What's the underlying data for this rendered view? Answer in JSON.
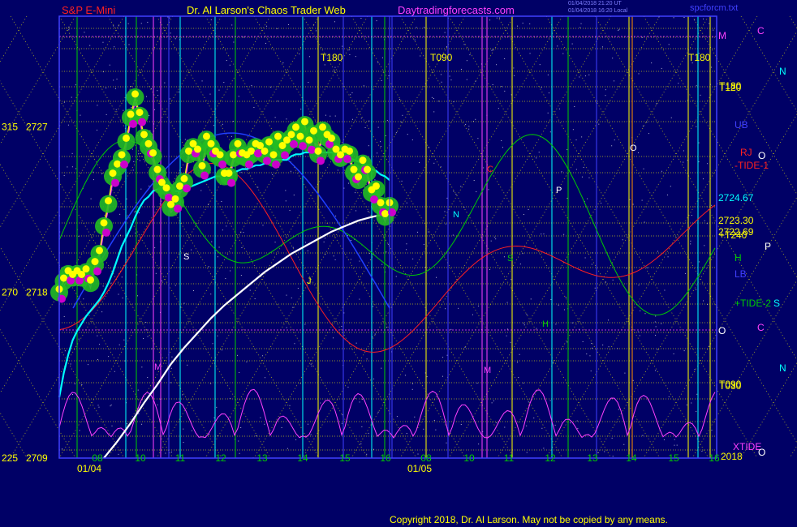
{
  "header": {
    "instrument": "S&P E-Mini",
    "site_title": "Dr. Al Larson's Chaos Trader Web",
    "site_url": "Daytradingforecasts.com",
    "stamp_line1": "01/04/2018 21:20 UT",
    "stamp_line2": "01/04/2018 16:20 Local",
    "file_name": "spcforcm.txt"
  },
  "footer": {
    "copyright": "Copyright 2018, Dr. Al Larson. May not be copied by any means."
  },
  "colors": {
    "background": "#000066",
    "price_bar": "#ffff00",
    "fast_average": "#00ffff",
    "slow_average": "#ffffff",
    "tide_curve": "#00cc00",
    "red_curve": "#ff2020",
    "xtide_curve": "#ff40ff",
    "grid_dots": "#ffff00"
  },
  "chart_data": {
    "type": "line",
    "y_axis_labels": [
      {
        "left": "315",
        "right": "2727"
      },
      {
        "left": "270",
        "right": "2718"
      },
      {
        "left": "225",
        "right": "2709"
      }
    ],
    "ylim": [
      2709,
      2733
    ],
    "x_hour_ticks": [
      "08",
      "10",
      "11",
      "12",
      "13",
      "14",
      "15",
      "16",
      "08",
      "10",
      "11",
      "12",
      "13",
      "14",
      "15",
      "16"
    ],
    "x_date_labels": [
      "01/04",
      "01/05"
    ],
    "right_year_label": "2018",
    "right_price_levels": [
      {
        "label": "2724.67",
        "value": 2724.67
      },
      {
        "label": "2723.30",
        "value": 2723.3
      },
      {
        "label": "2722.69",
        "value": 2722.69
      }
    ],
    "right_labels": [
      "T180",
      "T120",
      "UB",
      "RJ",
      "-TIDE-1",
      "+T240",
      "H",
      "LB",
      "+TIDE-2",
      "T090",
      "T030",
      "XTIDE"
    ],
    "top_labels": [
      "T180",
      "T090",
      "T180"
    ],
    "side_letters": [
      "C",
      "N",
      "M",
      "P",
      "S",
      "C",
      "N",
      "O",
      "O",
      "O"
    ],
    "curve_labels": [
      "N",
      "P",
      "S",
      "H",
      "M",
      "C",
      "O",
      "S",
      "M",
      "J"
    ],
    "series": [
      {
        "name": "",
        "x": [
          0.0,
          0.1,
          0.2,
          0.3,
          0.4,
          0.5,
          0.6,
          0.7,
          0.8,
          0.9,
          1.0,
          1.1,
          1.2,
          1.3,
          1.4,
          1.5,
          1.6,
          1.7,
          1.8,
          1.9,
          2.0,
          2.1,
          2.2,
          2.3,
          2.4,
          2.5,
          2.6,
          2.7,
          2.8,
          2.9,
          3.0,
          3.1,
          3.2,
          3.3,
          3.4,
          3.5,
          3.6,
          3.7,
          3.8,
          3.9,
          4.0,
          4.1,
          4.2,
          4.3,
          4.4,
          4.5,
          4.6,
          4.7,
          4.8,
          4.9,
          5.0,
          5.1,
          5.2,
          5.3,
          5.4,
          5.5,
          5.6,
          5.7,
          5.8,
          5.9,
          6.0,
          6.1,
          6.2,
          6.3,
          6.4,
          6.5,
          6.6,
          6.7,
          6.8,
          6.9,
          7.0,
          7.1,
          7.2,
          7.3,
          7.4
        ],
        "y": [
          2718.0,
          2718.6,
          2719.0,
          2718.8,
          2719.0,
          2718.8,
          2719.1,
          2718.5,
          2719.5,
          2720.1,
          2721.6,
          2722.8,
          2724.3,
          2724.8,
          2725.3,
          2726.2,
          2727.5,
          2728.6,
          2727.6,
          2726.4,
          2725.9,
          2725.4,
          2724.5,
          2723.8,
          2723.5,
          2722.6,
          2722.9,
          2723.6,
          2724.0,
          2725.5,
          2725.9,
          2725.6,
          2724.7,
          2726.3,
          2725.9,
          2725.5,
          2725.3,
          2724.3,
          2724.3,
          2725.3,
          2725.9,
          2725.4,
          2725.3,
          2725.5,
          2725.9,
          2725.8,
          2725.5,
          2726.0,
          2725.3,
          2726.3,
          2725.8,
          2726.1,
          2726.4,
          2726.8,
          2726.3,
          2727.1,
          2726.1,
          2726.6,
          2725.5,
          2726.8,
          2726.4,
          2726.2,
          2725.6,
          2725.3,
          2725.6,
          2725.5,
          2724.5,
          2724.1,
          2725.0,
          2724.5,
          2723.4,
          2723.6,
          2722.7,
          2722.1,
          2722.7
        ]
      },
      {
        "name": "",
        "x": [
          0.0,
          0.1,
          0.2,
          0.3,
          0.4,
          0.5,
          0.6,
          0.7,
          0.8,
          0.9,
          1.0,
          1.1,
          1.2,
          1.3,
          1.4,
          1.5,
          1.6,
          1.7,
          1.8,
          1.9,
          2.0,
          2.1,
          2.2,
          2.3,
          2.4,
          2.5,
          2.6,
          2.7,
          2.8,
          2.9,
          3.0,
          3.1,
          3.2,
          3.3,
          3.4,
          3.5,
          3.6,
          3.7,
          3.8,
          3.9,
          4.0,
          4.1,
          4.2,
          4.3,
          4.4,
          4.5,
          4.6,
          4.7,
          4.8,
          4.9,
          5.0,
          5.1,
          5.2,
          5.3,
          5.4,
          5.5,
          5.6,
          5.7,
          5.8,
          5.9,
          6.0,
          6.1,
          6.2,
          6.3,
          6.4,
          6.5,
          6.6,
          6.7,
          6.8,
          6.9,
          7.0,
          7.1,
          7.2,
          7.3,
          7.4
        ],
        "y": [
          2712.3,
          2713.6,
          2714.6,
          2715.4,
          2715.9,
          2716.3,
          2716.7,
          2717.0,
          2717.3,
          2717.6,
          2718.0,
          2718.5,
          2719.1,
          2719.8,
          2720.5,
          2721.0,
          2721.5,
          2722.1,
          2722.6,
          2723.0,
          2723.2,
          2723.5,
          2723.6,
          2723.6,
          2723.6,
          2723.6,
          2723.5,
          2723.5,
          2723.6,
          2723.7,
          2723.8,
          2723.9,
          2724.0,
          2724.1,
          2724.2,
          2724.3,
          2724.3,
          2724.3,
          2724.4,
          2724.5,
          2724.6,
          2724.7,
          2724.7,
          2724.8,
          2724.9,
          2724.9,
          2725.0,
          2725.1,
          2725.2,
          2725.2,
          2725.2,
          2725.2,
          2725.4,
          2725.5,
          2725.5,
          2725.6,
          2725.6,
          2725.6,
          2725.6,
          2725.6,
          2725.6,
          2725.6,
          2725.5,
          2725.5,
          2725.4,
          2725.3,
          2725.2,
          2725.1,
          2725.0,
          2724.8,
          2724.7,
          2724.6,
          2724.4,
          2724.3,
          2724.1
        ]
      },
      {
        "name": "",
        "x": [
          1.0,
          1.3,
          1.6,
          1.9,
          2.2,
          2.5,
          2.8,
          3.1,
          3.4,
          3.7,
          4.0,
          4.3,
          4.6,
          4.9,
          5.2,
          5.5,
          5.8,
          6.1,
          6.4,
          6.7,
          7.0,
          7.4
        ],
        "y": [
          2709.0,
          2709.9,
          2710.9,
          2712.0,
          2713.0,
          2714.1,
          2715.0,
          2715.8,
          2716.6,
          2717.3,
          2717.9,
          2718.5,
          2719.1,
          2719.6,
          2720.1,
          2720.5,
          2720.9,
          2721.3,
          2721.6,
          2721.9,
          2722.1,
          2722.3
        ]
      }
    ]
  }
}
